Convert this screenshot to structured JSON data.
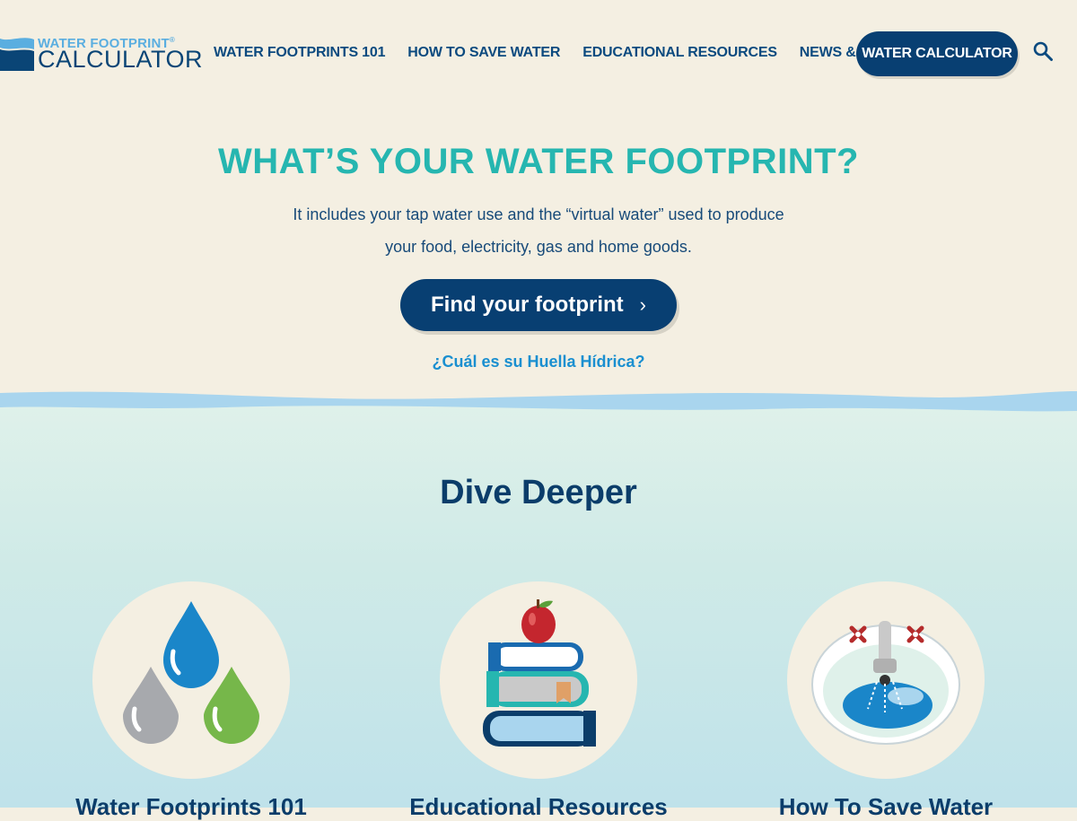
{
  "logo": {
    "top_text": "WATER FOOTPRINT",
    "registered": "®",
    "bottom_text": "CALCULATOR"
  },
  "nav": {
    "items": [
      {
        "label": "WATER FOOTPRINTS 101"
      },
      {
        "label": "HOW TO SAVE WATER"
      },
      {
        "label": "EDUCATIONAL RESOURCES"
      },
      {
        "label": "NEWS & ARTICLES"
      }
    ],
    "cta_label": "WATER CALCULATOR",
    "search_icon": "search-icon"
  },
  "hero": {
    "title": "WHAT’S YOUR WATER FOOTPRINT?",
    "subtitle_line1": "It includes your tap water use and the “virtual water” used to produce",
    "subtitle_line2": "your food, electricity, gas and home goods.",
    "button_label": "Find your footprint",
    "button_icon": "chevron-right-icon",
    "spanish_link": "¿Cuál es su Huella Hídrica?"
  },
  "dive": {
    "title": "Dive Deeper",
    "cards": [
      {
        "title": "Water Footprints 101",
        "icon": "water-drops-icon"
      },
      {
        "title": "Educational Resources",
        "icon": "books-apple-icon"
      },
      {
        "title": "How To Save Water",
        "icon": "sink-faucet-icon"
      }
    ]
  },
  "colors": {
    "navy": "#083f72",
    "teal": "#26b6b0",
    "link_blue": "#1a8fd0",
    "cream": "#f4efe2",
    "wave": "#a9d5ee"
  }
}
